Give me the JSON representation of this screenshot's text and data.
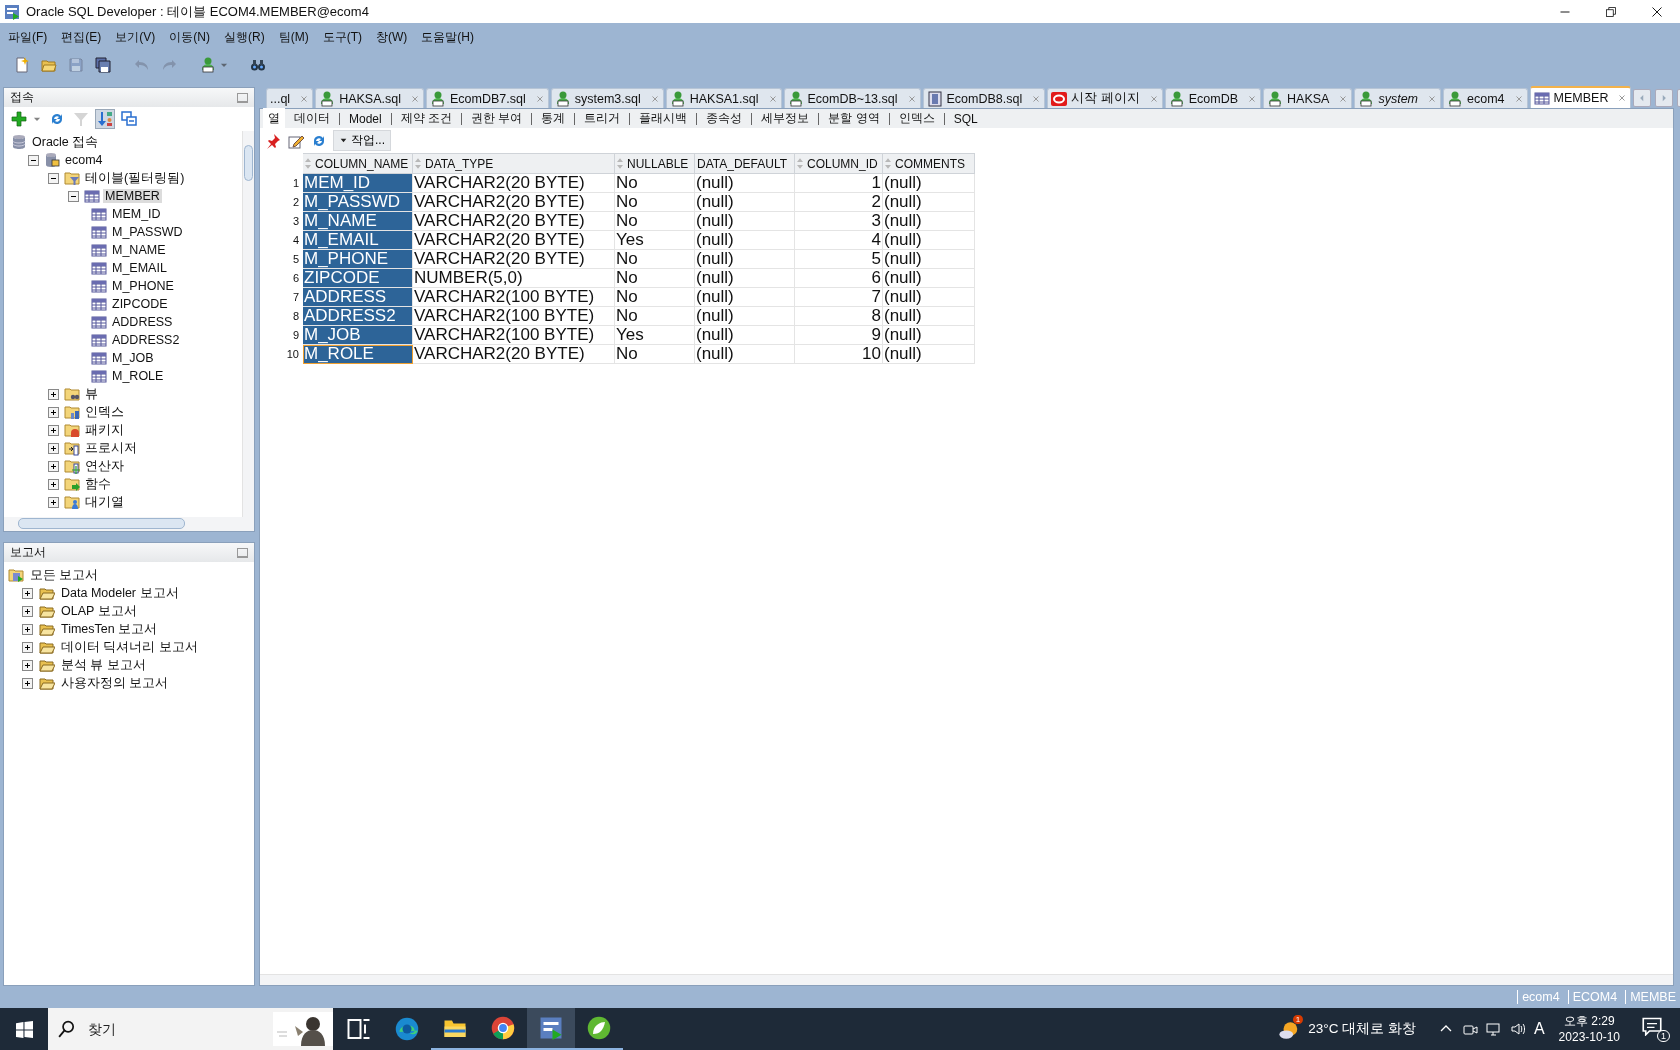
{
  "window": {
    "title": "Oracle SQL Developer : 테이블 ECOM4.MEMBER@ecom4"
  },
  "menu": [
    "파일(F)",
    "편집(E)",
    "보기(V)",
    "이동(N)",
    "실행(R)",
    "팀(M)",
    "도구(T)",
    "창(W)",
    "도움말(H)"
  ],
  "toolbar": [
    {
      "kind": "new",
      "disabled": false
    },
    {
      "kind": "open",
      "disabled": false
    },
    {
      "kind": "save",
      "disabled": true
    },
    {
      "kind": "save_all",
      "disabled": false
    },
    {
      "kind": "undo",
      "disabled": true
    },
    {
      "kind": "redo",
      "disabled": true
    },
    {
      "kind": "sql",
      "disabled": false
    },
    {
      "kind": "find",
      "disabled": false
    }
  ],
  "connections_panel": {
    "title": "접속",
    "tools": [
      {
        "kind": "add",
        "pressed": false,
        "disabled": false
      },
      {
        "kind": "refresh",
        "pressed": false,
        "disabled": false
      },
      {
        "kind": "filter",
        "pressed": false,
        "disabled": true
      },
      {
        "kind": "schema",
        "pressed": true,
        "disabled": false
      },
      {
        "kind": "collapse",
        "pressed": false,
        "disabled": false
      }
    ],
    "tree": [
      {
        "label": "Oracle 접속",
        "kind": "root",
        "selected": false,
        "children": [
          {
            "label": "ecom4",
            "kind": "connection",
            "expanded": true,
            "selected": false,
            "children": [
              {
                "label": "테이블(필터링됨)",
                "kind": "tables",
                "expanded": true,
                "selected": false,
                "children": [
                  {
                    "label": "MEMBER",
                    "kind": "table",
                    "expanded": true,
                    "selected": true,
                    "children": [
                      {
                        "label": "MEM_ID",
                        "kind": "column",
                        "selected": false
                      },
                      {
                        "label": "M_PASSWD",
                        "kind": "column",
                        "selected": false
                      },
                      {
                        "label": "M_NAME",
                        "kind": "column",
                        "selected": false
                      },
                      {
                        "label": "M_EMAIL",
                        "kind": "column",
                        "selected": false
                      },
                      {
                        "label": "M_PHONE",
                        "kind": "column",
                        "selected": false
                      },
                      {
                        "label": "ZIPCODE",
                        "kind": "column",
                        "selected": false
                      },
                      {
                        "label": "ADDRESS",
                        "kind": "column",
                        "selected": false
                      },
                      {
                        "label": "ADDRESS2",
                        "kind": "column",
                        "selected": false
                      },
                      {
                        "label": "M_JOB",
                        "kind": "column",
                        "selected": false
                      },
                      {
                        "label": "M_ROLE",
                        "kind": "column",
                        "selected": false
                      }
                    ]
                  }
                ]
              },
              {
                "label": "뷰",
                "kind": "views",
                "expanded": false,
                "selected": false
              },
              {
                "label": "인덱스",
                "kind": "indexes",
                "expanded": false,
                "selected": false
              },
              {
                "label": "패키지",
                "kind": "packages",
                "expanded": false,
                "selected": false
              },
              {
                "label": "프로시저",
                "kind": "procedures",
                "expanded": false,
                "selected": false
              },
              {
                "label": "연산자",
                "kind": "operators",
                "expanded": false,
                "selected": false
              },
              {
                "label": "함수",
                "kind": "functions",
                "expanded": false,
                "selected": false
              },
              {
                "label": "대기열",
                "kind": "queues",
                "expanded": false,
                "selected": false
              }
            ]
          }
        ]
      }
    ]
  },
  "reports_panel": {
    "title": "보고서",
    "tree": [
      {
        "label": "모든 보고서",
        "kind": "reports",
        "children": [
          {
            "label": "Data Modeler 보고서",
            "kind": "report_folder",
            "expanded": false
          },
          {
            "label": "OLAP 보고서",
            "kind": "report_folder",
            "expanded": false
          },
          {
            "label": "TimesTen 보고서",
            "kind": "report_folder",
            "expanded": false
          },
          {
            "label": "데이터 딕셔너리 보고서",
            "kind": "report_folder",
            "expanded": false
          },
          {
            "label": "분석 뷰 보고서",
            "kind": "report_folder",
            "expanded": false
          },
          {
            "label": "사용자정의 보고서",
            "kind": "report_folder",
            "expanded": false
          }
        ]
      }
    ]
  },
  "editor_tabs": [
    {
      "label": "...ql",
      "kind": "none",
      "selected": false,
      "italic": false
    },
    {
      "label": "HAKSA.sql",
      "kind": "sql",
      "selected": false,
      "italic": false
    },
    {
      "label": "EcomDB7.sql",
      "kind": "sql",
      "selected": false,
      "italic": false
    },
    {
      "label": "system3.sql",
      "kind": "sql",
      "selected": false,
      "italic": false
    },
    {
      "label": "HAKSA1.sql",
      "kind": "sql",
      "selected": false,
      "italic": false
    },
    {
      "label": "EcomDB~13.sql",
      "kind": "sql",
      "selected": false,
      "italic": false
    },
    {
      "label": "EcomDB8.sql",
      "kind": "doc",
      "selected": false,
      "italic": false
    },
    {
      "label": "시작 페이지",
      "kind": "start",
      "selected": false,
      "italic": false
    },
    {
      "label": "EcomDB",
      "kind": "sql",
      "selected": false,
      "italic": false
    },
    {
      "label": "HAKSA",
      "kind": "sql",
      "selected": false,
      "italic": false
    },
    {
      "label": "system",
      "kind": "sql",
      "selected": false,
      "italic": true
    },
    {
      "label": "ecom4",
      "kind": "sql",
      "selected": false,
      "italic": false
    },
    {
      "label": "MEMBER",
      "kind": "table",
      "selected": true,
      "italic": false
    }
  ],
  "sub_tabs": [
    {
      "label": "열",
      "selected": true
    },
    {
      "label": "데이터",
      "selected": false
    },
    {
      "label": "Model",
      "selected": false
    },
    {
      "label": "제약 조건",
      "selected": false
    },
    {
      "label": "권한 부여",
      "selected": false
    },
    {
      "label": "통계",
      "selected": false
    },
    {
      "label": "트리거",
      "selected": false
    },
    {
      "label": "플래시백",
      "selected": false
    },
    {
      "label": "종속성",
      "selected": false
    },
    {
      "label": "세부정보",
      "selected": false
    },
    {
      "label": "분할 영역",
      "selected": false
    },
    {
      "label": "인덱스",
      "selected": false
    },
    {
      "label": "SQL",
      "selected": false
    }
  ],
  "actions_button": "작업...",
  "table": {
    "columns": [
      "COLUMN_NAME",
      "DATA_TYPE",
      "NULLABLE",
      "DATA_DEFAULT",
      "COLUMN_ID",
      "COMMENTS"
    ],
    "rows": [
      {
        "num": "1",
        "cells": [
          "MEM_ID",
          "VARCHAR2(20 BYTE)",
          "No",
          "(null)",
          "1",
          "(null)"
        ],
        "selected": true,
        "focused": false
      },
      {
        "num": "2",
        "cells": [
          "M_PASSWD",
          "VARCHAR2(20 BYTE)",
          "No",
          "(null)",
          "2",
          "(null)"
        ],
        "selected": true,
        "focused": false
      },
      {
        "num": "3",
        "cells": [
          "M_NAME",
          "VARCHAR2(20 BYTE)",
          "No",
          "(null)",
          "3",
          "(null)"
        ],
        "selected": true,
        "focused": false
      },
      {
        "num": "4",
        "cells": [
          "M_EMAIL",
          "VARCHAR2(20 BYTE)",
          "Yes",
          "(null)",
          "4",
          "(null)"
        ],
        "selected": true,
        "focused": false
      },
      {
        "num": "5",
        "cells": [
          "M_PHONE",
          "VARCHAR2(20 BYTE)",
          "No",
          "(null)",
          "5",
          "(null)"
        ],
        "selected": true,
        "focused": false
      },
      {
        "num": "6",
        "cells": [
          "ZIPCODE",
          "NUMBER(5,0)",
          "No",
          "(null)",
          "6",
          "(null)"
        ],
        "selected": true,
        "focused": false
      },
      {
        "num": "7",
        "cells": [
          "ADDRESS",
          "VARCHAR2(100 BYTE)",
          "No",
          "(null)",
          "7",
          "(null)"
        ],
        "selected": true,
        "focused": false
      },
      {
        "num": "8",
        "cells": [
          "ADDRESS2",
          "VARCHAR2(100 BYTE)",
          "No",
          "(null)",
          "8",
          "(null)"
        ],
        "selected": true,
        "focused": false
      },
      {
        "num": "9",
        "cells": [
          "M_JOB",
          "VARCHAR2(100 BYTE)",
          "Yes",
          "(null)",
          "9",
          "(null)"
        ],
        "selected": true,
        "focused": false
      },
      {
        "num": "10",
        "cells": [
          "M_ROLE",
          "VARCHAR2(20 BYTE)",
          "No",
          "(null)",
          "10",
          "(null)"
        ],
        "selected": true,
        "focused": true
      }
    ]
  },
  "status_bar": [
    "ecom4",
    "ECOM4",
    "MEMBE"
  ],
  "taskbar": {
    "search": {
      "placeholder": "찾기"
    },
    "apps": [
      {
        "kind": "task_view",
        "running": false,
        "active": false
      },
      {
        "kind": "edge",
        "running": false,
        "active": false
      },
      {
        "kind": "explorer",
        "running": true,
        "active": false
      },
      {
        "kind": "chrome",
        "running": true,
        "active": false
      },
      {
        "kind": "sqldeveloper",
        "running": true,
        "active": true
      },
      {
        "kind": "spring",
        "running": true,
        "active": false
      }
    ],
    "weather": {
      "text": "23°C 대체로 화창",
      "badge": "1"
    },
    "ime": "A",
    "time": "오후 2:29",
    "date": "2023-10-10",
    "notifications": "1"
  }
}
